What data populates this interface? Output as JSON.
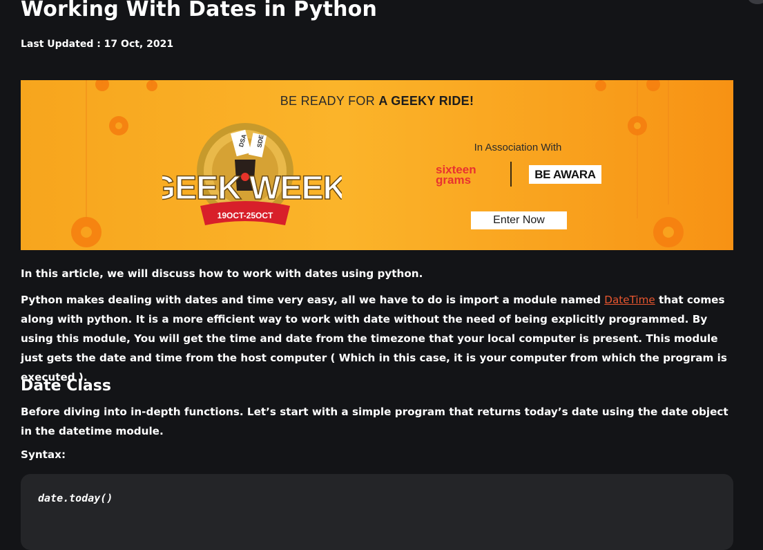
{
  "article": {
    "title": "Working With Dates in Python",
    "last_updated": "Last Updated : 17 Oct, 2021"
  },
  "banner": {
    "headline_prefix": "BE READY FOR ",
    "headline_bold": "A GEEKY RIDE!",
    "logo_text": "GEEK WEEK",
    "logo_dates": "19OCT-25OCT",
    "logo_tags": [
      "DSA",
      "SDE"
    ],
    "association_label": "In Association With",
    "partner1": "sixteen grams",
    "partner2": "BE AWARA",
    "cta_label": "Enter Now"
  },
  "content": {
    "intro": "In this article, we will discuss how to work with dates using python.",
    "para2_before_link": "Python makes dealing with dates and time very easy, all we have to do is import a module named ",
    "para2_link": "DateTime",
    "para2_after_link": " that comes along with python. It is a more efficient way to work with date without the need of being explicitly programmed.  By using this module, You will get the time and date from the timezone that your local computer is present. This module just gets the date and time from the host computer ( Which in this case, it is your computer from which the program is executed ).",
    "section_heading": "Date Class",
    "section_para": "Before diving into in-depth functions. Let’s start with a simple program that returns today’s date using the date object in the datetime module.",
    "syntax_label": "Syntax:",
    "code": "date.today()"
  },
  "colors": {
    "background": "#131417",
    "link": "#e8562f",
    "banner_orange": "#f9a21e",
    "code_bg": "#242528"
  }
}
